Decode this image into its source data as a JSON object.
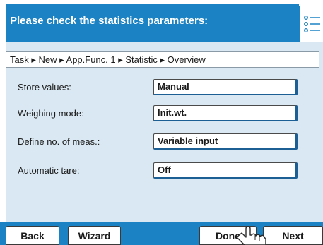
{
  "header": {
    "title": "Please check the statistics parameters:"
  },
  "breadcrumb": "Task ▸ New ▸ App.Func. 1 ▸ Statistic ▸ Overview",
  "rows": [
    {
      "label": "Store values:",
      "value": "Manual"
    },
    {
      "label": "Weighing mode:",
      "value": "Init.wt."
    },
    {
      "label": "Define no. of meas.:",
      "value": "Variable input"
    },
    {
      "label": "Automatic tare:",
      "value": "Off"
    }
  ],
  "footer": {
    "back": "Back",
    "wizard": "Wizard",
    "done": "Done",
    "next": "Next"
  },
  "colors": {
    "accent": "#1b82c4",
    "panel": "#d9e8f2"
  },
  "icons": [
    "list-icon",
    "pointer-hand-icon"
  ]
}
